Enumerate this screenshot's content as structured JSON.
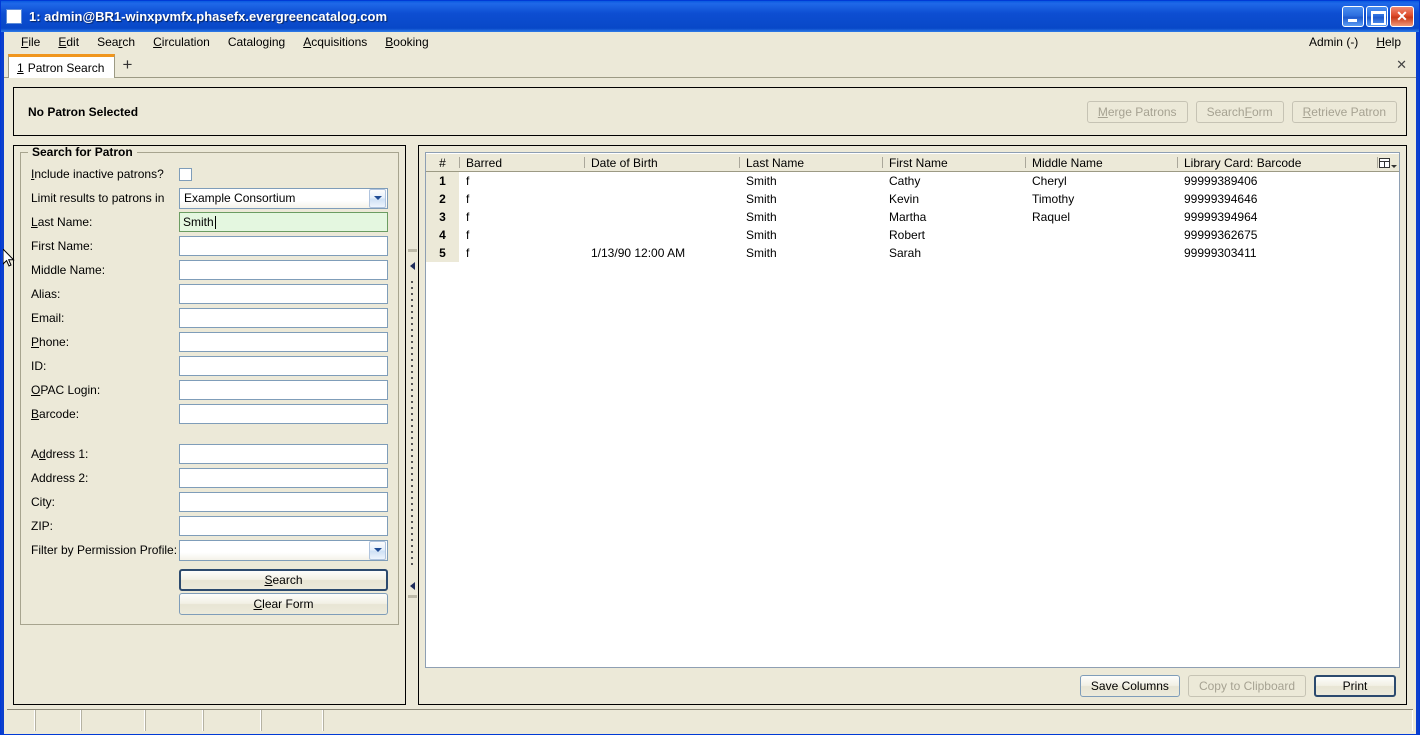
{
  "window": {
    "title": "1: admin@BR1-winxpvmfx.phasefx.evergreencatalog.com",
    "minimize_label": "",
    "maximize_label": "",
    "close_label": "✕"
  },
  "menubar": {
    "items": [
      {
        "label": "File",
        "accel": "F"
      },
      {
        "label": "Edit",
        "accel": "E"
      },
      {
        "label": "Search",
        "accel": "r"
      },
      {
        "label": "Circulation",
        "accel": "C"
      },
      {
        "label": "Cataloging",
        "accel": "g"
      },
      {
        "label": "Acquisitions",
        "accel": "A"
      },
      {
        "label": "Booking",
        "accel": "B"
      }
    ],
    "right_items": [
      {
        "label": "Admin (-)"
      },
      {
        "label": "Help",
        "accel": "H"
      }
    ]
  },
  "tabs": {
    "active": {
      "number": "1",
      "label": "Patron Search"
    },
    "new_tab_label": "+",
    "close_label": "✕"
  },
  "patron_bar": {
    "title": "No Patron Selected",
    "buttons": [
      {
        "label": "Merge Patrons",
        "disabled": true
      },
      {
        "label": "Search Form",
        "disabled": true
      },
      {
        "label": "Retrieve Patron",
        "disabled": true
      }
    ]
  },
  "search_form": {
    "legend": "Search for Patron",
    "include_inactive_label": "Include inactive patrons?",
    "include_inactive_checked": false,
    "limit_results_label": "Limit results to patrons in",
    "limit_results_value": "Example Consortium",
    "fields": [
      {
        "label": "Last Name:",
        "value": "Smith",
        "focused": true
      },
      {
        "label": "First Name:",
        "value": "",
        "focused": false
      },
      {
        "label": "Middle Name:",
        "value": "",
        "focused": false
      },
      {
        "label": "Alias:",
        "value": "",
        "focused": false
      },
      {
        "label": "Email:",
        "value": "",
        "focused": false
      },
      {
        "label": "Phone:",
        "value": "",
        "focused": false
      },
      {
        "label": "ID:",
        "value": "",
        "focused": false
      },
      {
        "label": "OPAC Login:",
        "value": "",
        "focused": false
      },
      {
        "label": "Barcode:",
        "value": "",
        "focused": false
      }
    ],
    "address_fields": [
      {
        "label": "Address 1:",
        "value": ""
      },
      {
        "label": "Address 2:",
        "value": ""
      },
      {
        "label": "City:",
        "value": ""
      },
      {
        "label": "ZIP:",
        "value": ""
      }
    ],
    "permission_profile_label": "Filter by Permission Profile:",
    "permission_profile_value": "",
    "search_button": "Search",
    "clear_button": "Clear Form"
  },
  "results": {
    "columns": [
      "#",
      "Barred",
      "Date of Birth",
      "Last Name",
      "First Name",
      "Middle Name",
      "Library Card: Barcode"
    ],
    "rows": [
      {
        "num": "1",
        "barred": "f",
        "dob": "",
        "last": "Smith",
        "first": "Cathy",
        "middle": "Cheryl",
        "barcode": "99999389406"
      },
      {
        "num": "2",
        "barred": "f",
        "dob": "",
        "last": "Smith",
        "first": "Kevin",
        "middle": "Timothy",
        "barcode": "99999394646"
      },
      {
        "num": "3",
        "barred": "f",
        "dob": "",
        "last": "Smith",
        "first": "Martha",
        "middle": "Raquel",
        "barcode": "99999394964"
      },
      {
        "num": "4",
        "barred": "f",
        "dob": "",
        "last": "Smith",
        "first": "Robert",
        "middle": "",
        "barcode": "99999362675"
      },
      {
        "num": "5",
        "barred": "f",
        "dob": "1/13/90 12:00 AM",
        "last": "Smith",
        "first": "Sarah",
        "middle": "",
        "barcode": "99999303411"
      }
    ],
    "footer_buttons": [
      {
        "label": "Save Columns",
        "disabled": false,
        "default": false
      },
      {
        "label": "Copy to Clipboard",
        "disabled": true,
        "default": false
      },
      {
        "label": "Print",
        "disabled": false,
        "default": true
      }
    ]
  },
  "statusbar": {
    "segments": [
      "",
      "",
      "",
      "",
      "",
      "",
      ""
    ]
  },
  "colors": {
    "title_blue": "#0b3fce",
    "face": "#ece9d8",
    "field_focus_green": "#e4f7e0",
    "tab_accent_orange": "#f0961e",
    "field_border": "#7f9db9"
  }
}
